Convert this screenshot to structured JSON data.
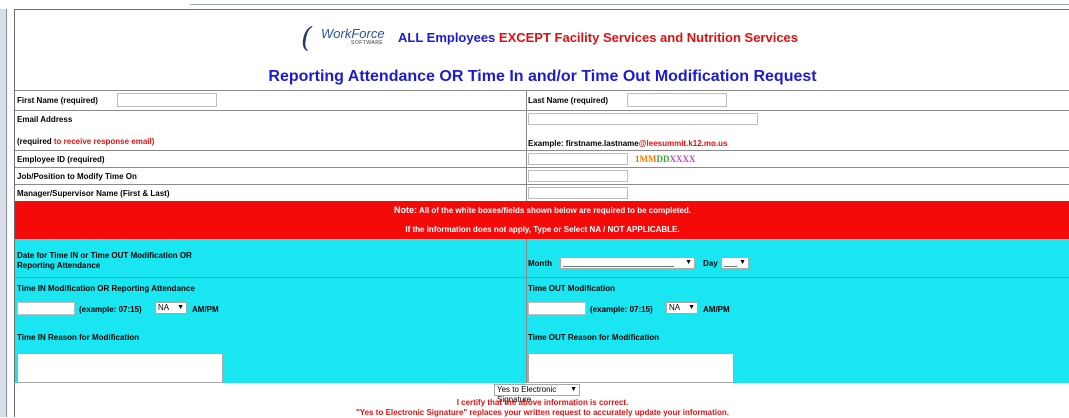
{
  "logo": {
    "brand": "WorkForce",
    "sub": "SOFTWARE"
  },
  "header": {
    "audience_prefix": "ALL Employees ",
    "audience_highlight": "EXCEPT Facility Services and Nutrition Services",
    "title": "Reporting Attendance OR Time In and/or Time Out Modification Request"
  },
  "fields": {
    "first_name_label": "First Name (required)",
    "first_name_value": "",
    "last_name_label": "Last Name (required)",
    "last_name_value": "",
    "email_label": "Email Address",
    "email_required_prefix": "(required",
    "email_required_suffix": " to receive response email)",
    "email_value": "",
    "email_example_prefix": "Example:  firstname.lastname",
    "email_example_domain": "@leesummit.k12.mo.us",
    "employee_id_label": "Employee ID (required)",
    "employee_id_value": "",
    "employee_id_format": [
      "1",
      "MM",
      "DD",
      "XXXX"
    ],
    "job_label": "Job/Position to Modify Time On",
    "job_value": "",
    "manager_label": "Manager/Supervisor Name (First & Last)",
    "manager_value": ""
  },
  "note": {
    "note_word": "Note:",
    "line1": "  All of the white boxes/fields shown below are required to be completed.",
    "line2": "If the information does not apply, Type or Select NA / NOT APPLICABLE."
  },
  "date_section": {
    "label_line1": "Date for Time IN or Time OUT Modification OR",
    "label_line2": "Reporting Attendance",
    "month_label": "Month",
    "month_value": "_________________________",
    "day_label": "Day",
    "day_value": "___"
  },
  "time_in": {
    "label": "Time IN Modification OR Reporting Attendance",
    "example": "(example:  07:15)",
    "ampm_value": "NA",
    "ampm_label": "AM/PM",
    "reason_label": "Time IN Reason for Modification",
    "time_value": "",
    "reason_value": ""
  },
  "time_out": {
    "label": "Time OUT Modification",
    "example": "(example:  07:15)",
    "ampm_value": "NA",
    "ampm_label": "AM/PM",
    "reason_label": "Time OUT Reason for Modification",
    "time_value": "",
    "reason_value": ""
  },
  "signature": {
    "select_value": "Yes to Electronic Signature",
    "certify": "I certify that the above information is correct.",
    "replaces": "\"Yes to Electronic Signature\" replaces your written request to accurately update your information."
  },
  "colors": {
    "title_blue": "#1b1bd6",
    "alert_red": "#f50a0a",
    "section_cyan": "#19e6f0"
  },
  "icons": {
    "dropdown": "caret-down-icon",
    "logo": "workforce-logo-icon"
  }
}
